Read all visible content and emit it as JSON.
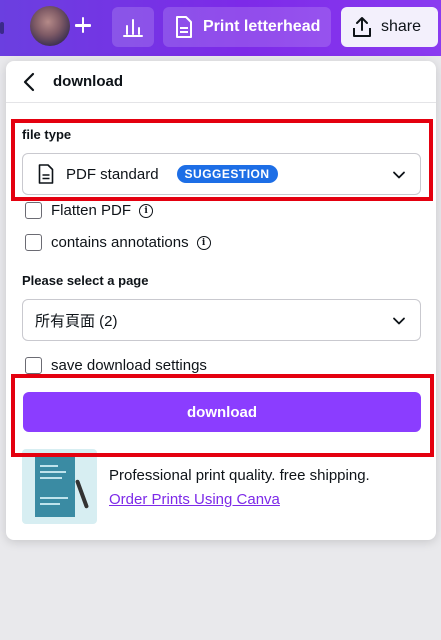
{
  "topbar": {
    "print_label": "Print letterhead",
    "share_label": "share"
  },
  "panel": {
    "title": "download",
    "file_type": {
      "label": "file type",
      "value": "PDF standard",
      "badge": "SUGGESTION"
    },
    "options": {
      "flatten_pdf": "Flatten PDF",
      "contains_annotations": "contains annotations"
    },
    "pages": {
      "label": "Please select a page",
      "value": "所有頁面 (2)"
    },
    "save_settings": "save download settings",
    "download_button": "download",
    "promo": {
      "text": "Professional print quality. free shipping.",
      "link": "Order Prints Using Canva"
    }
  },
  "colors": {
    "accent": "#8b3dff",
    "highlight": "#e4000f",
    "badge": "#1d6ee6"
  }
}
